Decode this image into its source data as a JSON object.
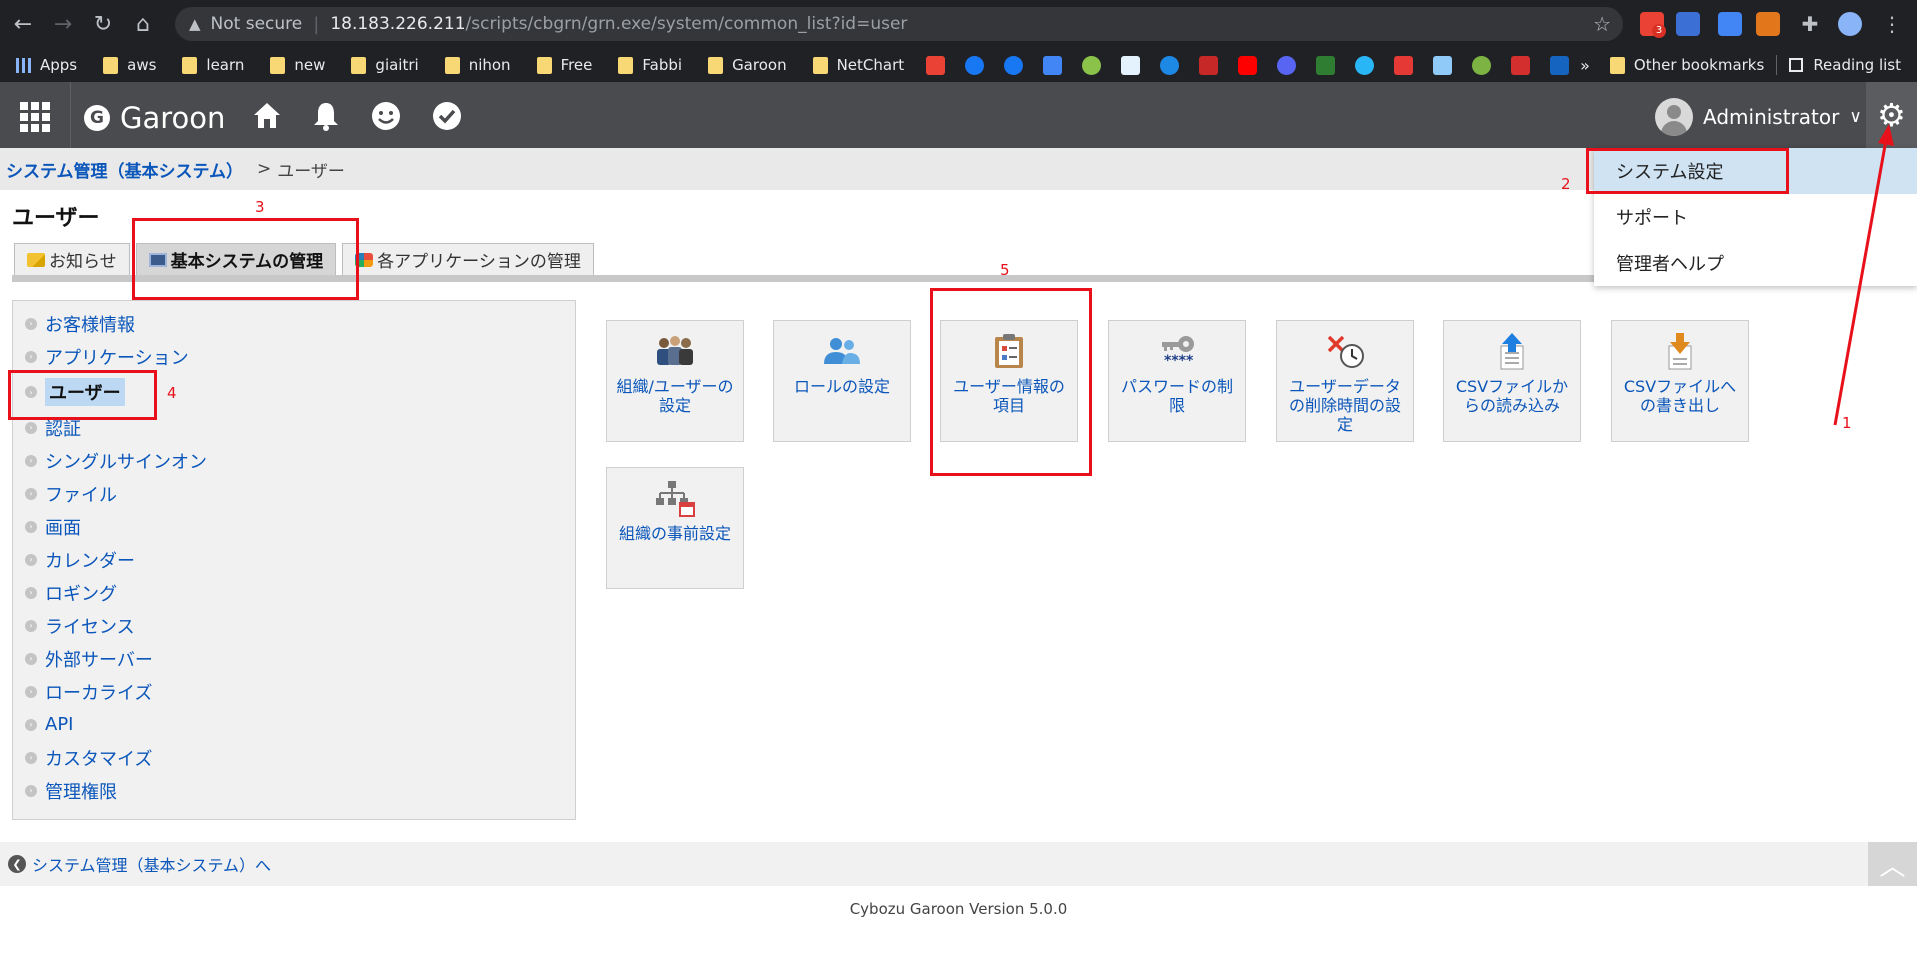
{
  "browser": {
    "security_label": "Not secure",
    "url_host": "18.183.226.211",
    "url_path": "/scripts/cbgrn/grn.exe/system/common_list?id=user",
    "mail_badge": "3",
    "bookmarks": [
      {
        "label": "Apps"
      },
      {
        "label": "aws"
      },
      {
        "label": "learn"
      },
      {
        "label": "new"
      },
      {
        "label": "giaitri"
      },
      {
        "label": "nihon"
      },
      {
        "label": "Free"
      },
      {
        "label": "Fabbi"
      },
      {
        "label": "Garoon"
      },
      {
        "label": "NetChart"
      }
    ],
    "overflow": "»",
    "other_bookmarks": "Other bookmarks",
    "reading_list": "Reading list"
  },
  "header": {
    "logo_letter": "G",
    "logo_text": "Garoon",
    "user_name": "Administrator"
  },
  "breadcrumb": {
    "parent": "システム管理（基本システム）",
    "separator": ">",
    "current": "ユーザー"
  },
  "page": {
    "title": "ユーザー",
    "tabs": [
      {
        "label": "お知らせ"
      },
      {
        "label": "基本システムの管理"
      },
      {
        "label": "各アプリケーションの管理"
      }
    ]
  },
  "sidebar": {
    "items": [
      {
        "label": "お客様情報"
      },
      {
        "label": "アプリケーション"
      },
      {
        "label": "ユーザー"
      },
      {
        "label": "認証"
      },
      {
        "label": "シングルサインオン"
      },
      {
        "label": "ファイル"
      },
      {
        "label": "画面"
      },
      {
        "label": "カレンダー"
      },
      {
        "label": "ロギング"
      },
      {
        "label": "ライセンス"
      },
      {
        "label": "外部サーバー"
      },
      {
        "label": "ローカライズ"
      },
      {
        "label": "API"
      },
      {
        "label": "カスタマイズ"
      },
      {
        "label": "管理権限"
      }
    ]
  },
  "tiles": [
    {
      "label": "組織/ユーザーの設定"
    },
    {
      "label": "ロールの設定"
    },
    {
      "label": "ユーザー情報の項目"
    },
    {
      "label": "パスワードの制限"
    },
    {
      "label": "ユーザーデータの削除時間の設定"
    },
    {
      "label": "CSVファイルからの読み込み"
    },
    {
      "label": "CSVファイルへの書き出し"
    },
    {
      "label": "組織の事前設定"
    }
  ],
  "dropdown": {
    "items": [
      {
        "label": "システム設定"
      },
      {
        "label": "サポート"
      },
      {
        "label": "管理者ヘルプ"
      }
    ]
  },
  "footer": {
    "back_link": "システム管理（基本システム）へ",
    "version": "Cybozu Garoon Version 5.0.0"
  },
  "annotations": {
    "n1": "1",
    "n2": "2",
    "n3": "3",
    "n4": "4",
    "n5": "5",
    "color": "#e8111b"
  }
}
